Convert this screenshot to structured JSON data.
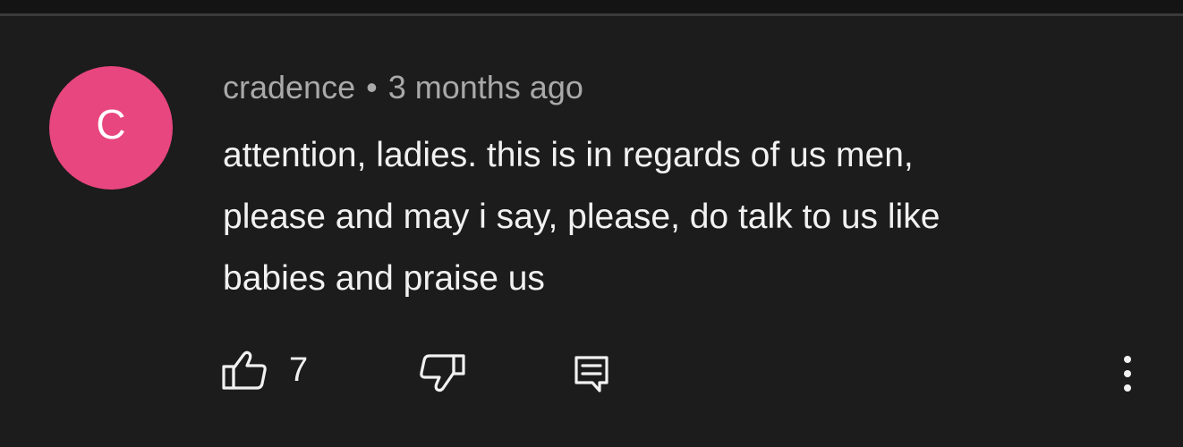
{
  "comment": {
    "avatar_letter": "C",
    "avatar_color": "#e8467e",
    "author": "cradence",
    "separator": "•",
    "timestamp": "3 months ago",
    "text_lines": [
      "attention, ladies. this is in regards of us men,",
      "please and may i say, please, do talk to us like",
      "babies and praise us"
    ],
    "like_count": "7"
  },
  "icons": {
    "like": "thumbs-up-icon",
    "dislike": "thumbs-down-icon",
    "reply": "comment-reply-icon",
    "more": "more-vertical-icon"
  },
  "colors": {
    "background": "#1c1c1c",
    "text": "#f1f1f1",
    "meta_text": "#a9a9a9"
  }
}
